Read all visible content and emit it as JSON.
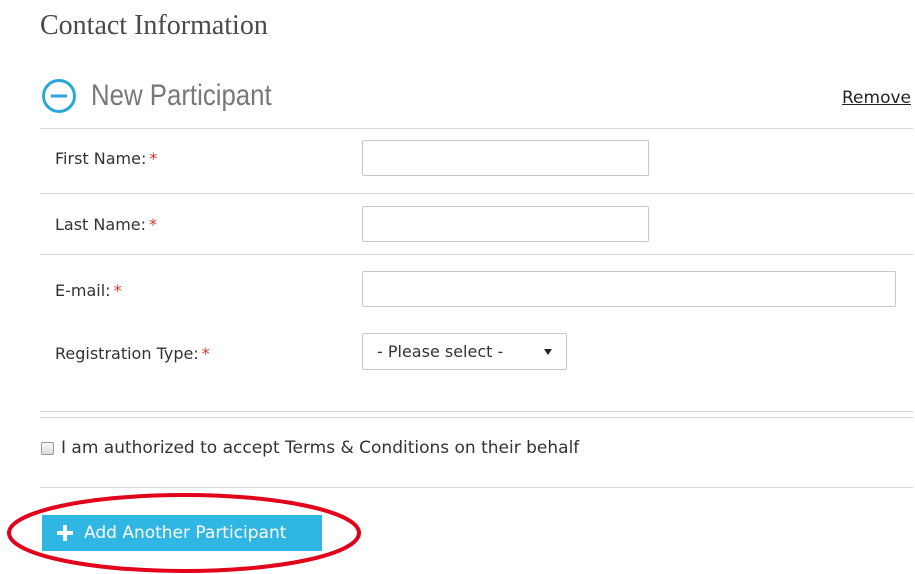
{
  "section": {
    "title": "Contact Information"
  },
  "participant": {
    "title": "New Participant",
    "collapse_icon": "minus-circle-icon",
    "accent_color": "#2aa6dc",
    "remove_label": "Remove"
  },
  "form": {
    "required_marker": "*",
    "fields": [
      {
        "label": "First Name:",
        "value": ""
      },
      {
        "label": "Last Name:",
        "value": ""
      },
      {
        "label": "E-mail:",
        "value": ""
      },
      {
        "label": "Registration Type:",
        "selected": "- Please select -"
      }
    ]
  },
  "terms": {
    "label": "I am authorized to accept Terms & Conditions on their behalf",
    "checked": false
  },
  "add_button": {
    "label": "Add Another Participant",
    "icon": "plus-icon",
    "color": "#2fb6e2"
  },
  "annotation": {
    "highlight_color": "#e2001a"
  }
}
